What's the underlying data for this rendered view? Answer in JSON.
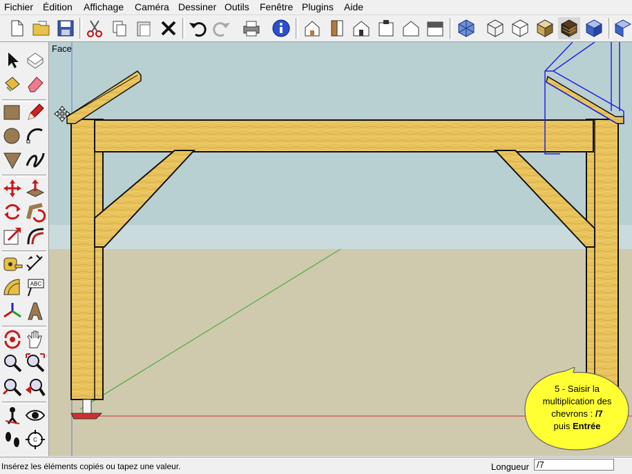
{
  "menu": {
    "items": [
      "Fichier",
      "Édition",
      "Affichage",
      "Caméra",
      "Dessiner",
      "Outils",
      "Fenêtre",
      "Plugins",
      "Aide"
    ]
  },
  "toolbar": {
    "buttons": [
      {
        "name": "new-file-icon"
      },
      {
        "name": "open-folder-icon"
      },
      {
        "name": "save-icon"
      },
      {
        "name": "cut-icon"
      },
      {
        "name": "copy-icon"
      },
      {
        "name": "paste-icon"
      },
      {
        "name": "erase-x-icon"
      },
      {
        "name": "undo-icon"
      },
      {
        "name": "redo-icon"
      },
      {
        "name": "print-icon"
      },
      {
        "name": "model-info-icon"
      },
      {
        "name": "iso-view-icon"
      },
      {
        "name": "top-view-icon"
      },
      {
        "name": "front-view-icon"
      },
      {
        "name": "right-view-icon"
      },
      {
        "name": "back-view-icon"
      },
      {
        "name": "left-view-icon"
      },
      {
        "name": "xray-icon"
      },
      {
        "name": "wireframe-icon"
      },
      {
        "name": "hidden-line-icon"
      },
      {
        "name": "shaded-icon"
      },
      {
        "name": "textured-icon"
      },
      {
        "name": "monochrome-icon"
      },
      {
        "name": "extra-icon"
      }
    ]
  },
  "left_tools": [
    {
      "name": "select-arrow-icon"
    },
    {
      "name": "make-component-icon"
    },
    {
      "name": "paint-bucket-icon"
    },
    {
      "name": "eraser-icon"
    },
    {
      "name": "rectangle-icon"
    },
    {
      "name": "pencil-icon"
    },
    {
      "name": "circle-icon"
    },
    {
      "name": "arc-icon"
    },
    {
      "name": "polygon-icon"
    },
    {
      "name": "freehand-icon"
    },
    {
      "name": "move-icon"
    },
    {
      "name": "push-pull-icon"
    },
    {
      "name": "rotate-icon"
    },
    {
      "name": "follow-me-icon"
    },
    {
      "name": "scale-icon"
    },
    {
      "name": "offset-icon"
    },
    {
      "name": "tape-measure-icon"
    },
    {
      "name": "dimensions-icon"
    },
    {
      "name": "protractor-icon"
    },
    {
      "name": "text-icon"
    },
    {
      "name": "axes-icon"
    },
    {
      "name": "3d-text-icon"
    },
    {
      "name": "orbit-icon"
    },
    {
      "name": "pan-icon"
    },
    {
      "name": "zoom-icon"
    },
    {
      "name": "zoom-window-icon"
    },
    {
      "name": "zoom-extents-icon"
    },
    {
      "name": "previous-view-icon"
    },
    {
      "name": "position-camera-icon"
    },
    {
      "name": "look-around-icon"
    },
    {
      "name": "walk-icon"
    },
    {
      "name": "section-plane-icon"
    }
  ],
  "viewport": {
    "scene_label": "Face"
  },
  "callout": {
    "line1": "5 - Saisir la",
    "line2": "multiplication des",
    "line3_pre": "chevrons : ",
    "line3_bold": "/7",
    "line4_pre": "puis ",
    "line4_bold": "Entrée"
  },
  "status": {
    "hint": "Insérez les éléments copiés ou tapez une valeur.",
    "measure_label": "Longueur",
    "measure_value": "/7"
  },
  "colors": {
    "sky": "#b9d0d3",
    "ground": "#cfc9ad",
    "wood": "#e8c25a",
    "selection": "#2020e0",
    "callout": "#ffff33"
  }
}
